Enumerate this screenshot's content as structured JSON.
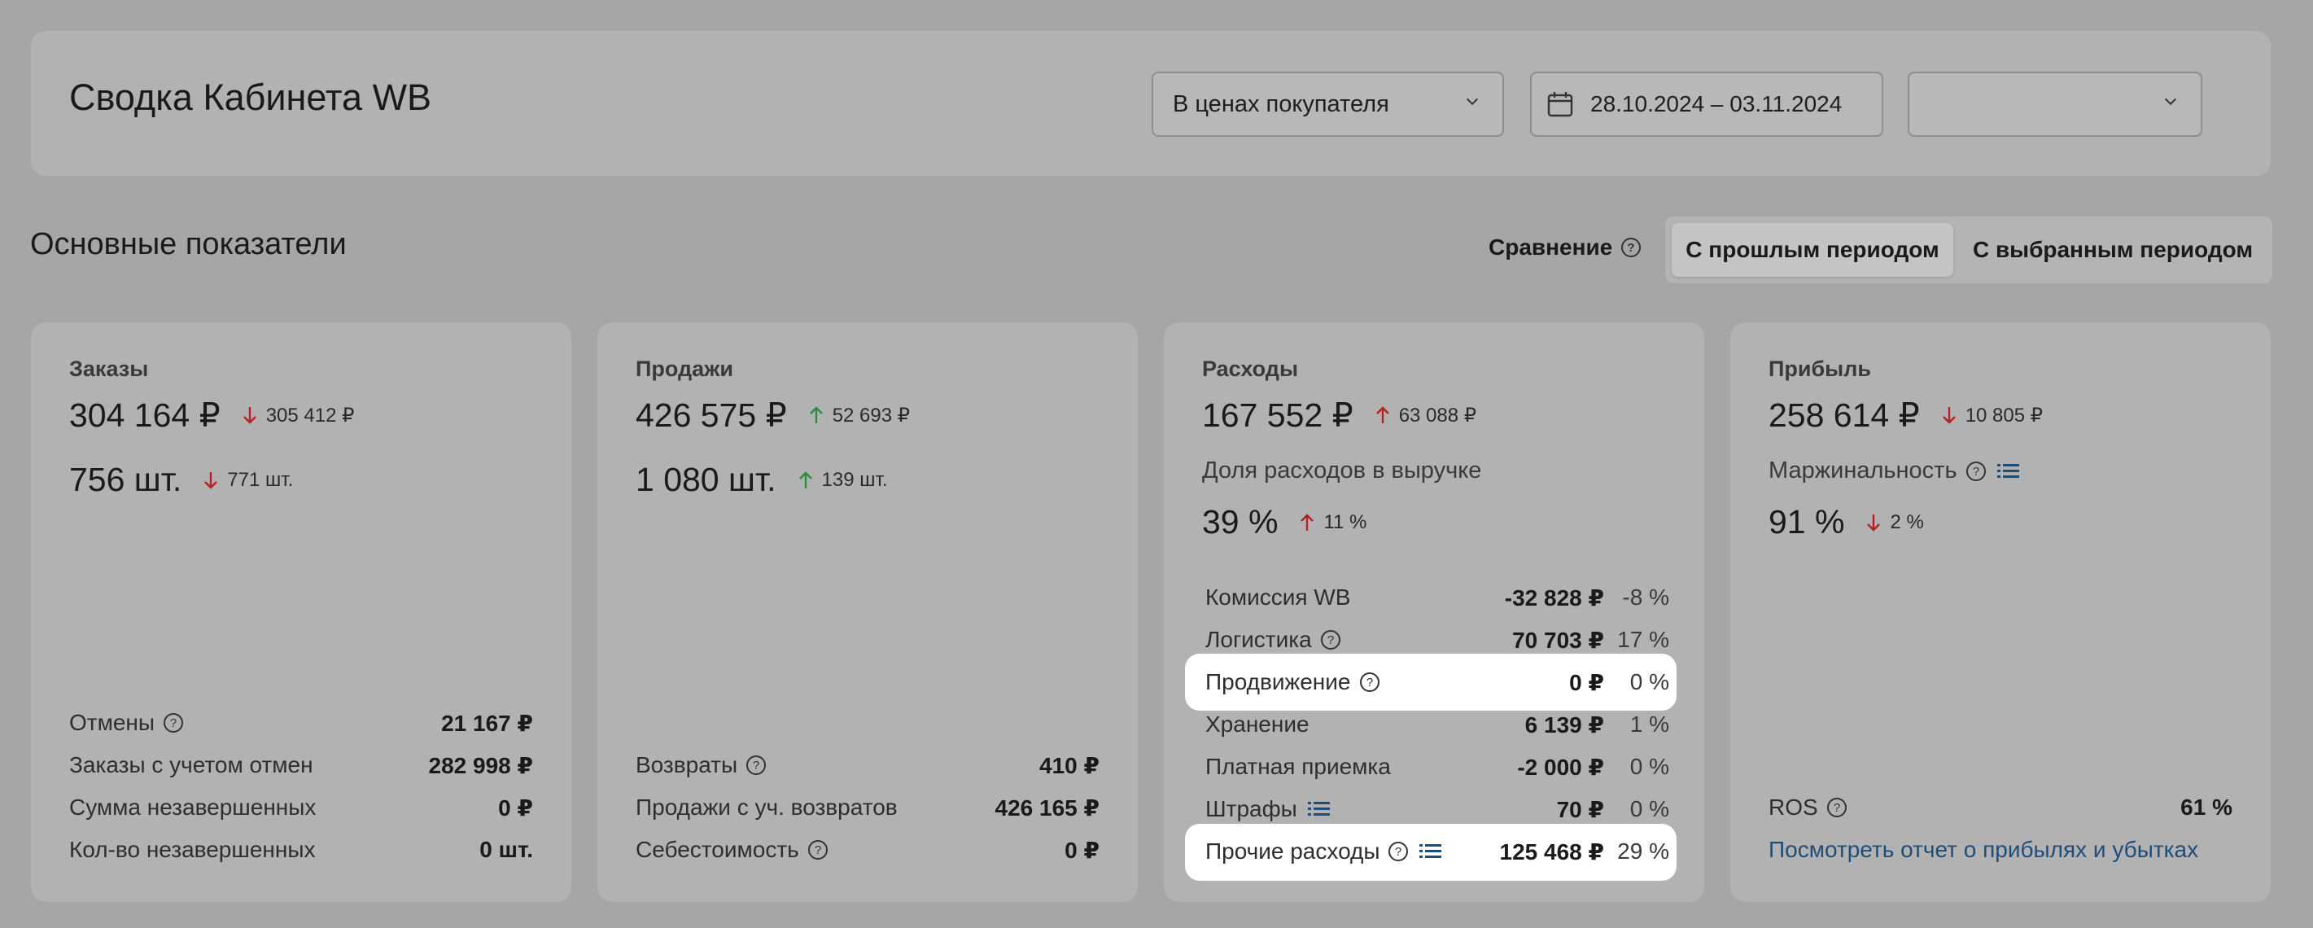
{
  "header": {
    "title": "Сводка Кабинета WB",
    "price_select": "В ценах покупателя",
    "date_range": "28.10.2024 – 03.11.2024",
    "extra_select": ""
  },
  "section": {
    "title": "Основные показатели",
    "compare_label": "Сравнение",
    "compare_options": [
      "С прошлым периодом",
      "С выбранным периодом"
    ],
    "selected_option": "С прошлым периодом"
  },
  "colors": {
    "up": "#2e8b3e",
    "down": "#b22222",
    "highlight": "#ffffff",
    "link": "#1f4d7a"
  },
  "cards": {
    "orders": {
      "title": "Заказы",
      "amount": "304 164 ₽",
      "amount_delta": "305 412 ₽",
      "amount_dir": "down",
      "qty": "756 шт.",
      "qty_delta": "771 шт.",
      "qty_dir": "down",
      "rows": [
        {
          "label": "Отмены",
          "value": "21 167 ₽",
          "help": true
        },
        {
          "label": "Заказы с учетом отмен",
          "value": "282 998 ₽"
        },
        {
          "label": "Сумма незавершенных",
          "value": "0 ₽"
        },
        {
          "label": "Кол-во незавершенных",
          "value": "0 шт."
        }
      ]
    },
    "sales": {
      "title": "Продажи",
      "amount": "426 575 ₽",
      "amount_delta": "52 693 ₽",
      "amount_dir": "up",
      "qty": "1 080 шт.",
      "qty_delta": "139 шт.",
      "qty_dir": "up",
      "rows": [
        {
          "label": "Возвраты",
          "value": "410 ₽",
          "help": true
        },
        {
          "label": "Продажи с уч. возвратов",
          "value": "426 165 ₽"
        },
        {
          "label": "Себестоимость",
          "value": "0 ₽",
          "help": true
        }
      ]
    },
    "expenses": {
      "title": "Расходы",
      "amount": "167 552 ₽",
      "amount_delta": "63 088 ₽",
      "amount_dir": "up",
      "share_label": "Доля расходов в выручке",
      "share": "39 %",
      "share_delta": "11 %",
      "share_dir": "up",
      "rows": [
        {
          "label": "Комиссия WB",
          "value": "-32 828 ₽",
          "pct": "-8 %"
        },
        {
          "label": "Логистика",
          "value": "70 703 ₽",
          "pct": "17 %",
          "help": true
        },
        {
          "label": "Продвижение",
          "value": "0 ₽",
          "pct": "0 %",
          "help": true,
          "highlight": true
        },
        {
          "label": "Хранение",
          "value": "6 139 ₽",
          "pct": "1 %"
        },
        {
          "label": "Платная приемка",
          "value": "-2 000 ₽",
          "pct": "0 %"
        },
        {
          "label": "Штрафы",
          "value": "70 ₽",
          "pct": "0 %",
          "list": true
        },
        {
          "label": "Прочие расходы",
          "value": "125 468 ₽",
          "pct": "29 %",
          "help": true,
          "list": true,
          "highlight": true
        }
      ]
    },
    "profit": {
      "title": "Прибыль",
      "amount": "258 614 ₽",
      "amount_delta": "10 805 ₽",
      "amount_dir": "down",
      "margin_label": "Маржинальность",
      "margin": "91 %",
      "margin_delta": "2 %",
      "margin_dir": "down",
      "ros_label": "ROS",
      "ros_value": "61 %",
      "report_link": "Посмотреть отчет о прибылях и убытках"
    }
  }
}
